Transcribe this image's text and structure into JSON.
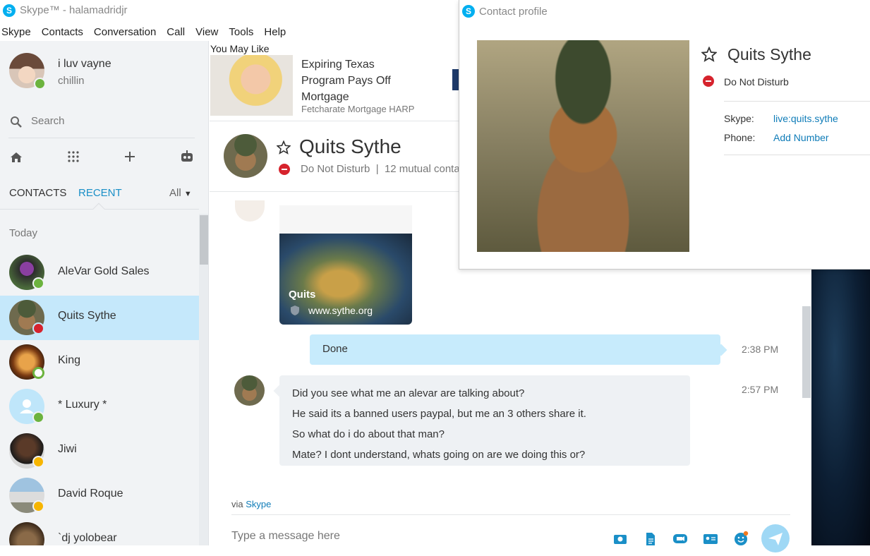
{
  "window": {
    "title": "Skype™ - halamadridjr"
  },
  "menu": [
    "Skype",
    "Contacts",
    "Conversation",
    "Call",
    "View",
    "Tools",
    "Help"
  ],
  "me": {
    "name": "i luv vayne",
    "mood": "chillin"
  },
  "search": {
    "placeholder": "Search"
  },
  "tabs": {
    "contacts": "CONTACTS",
    "recent": "RECENT",
    "filter": "All"
  },
  "section": "Today",
  "contacts": [
    {
      "name": "AleVar Gold Sales",
      "status": "online"
    },
    {
      "name": "Quits Sythe",
      "status": "dnd"
    },
    {
      "name": "King",
      "status": "offline"
    },
    {
      "name": "* Luxury *",
      "status": "online"
    },
    {
      "name": "Jiwi",
      "status": "away"
    },
    {
      "name": "David Roque",
      "status": "away"
    },
    {
      "name": "`dj yolobear",
      "status": "away"
    }
  ],
  "ad": {
    "header": "You May Like",
    "title_l1": "Expiring Texas",
    "title_l2": "Program Pays Off",
    "title_l3": "Mortgage",
    "source": "Fetcharate Mortgage HARP"
  },
  "conversation": {
    "name": "Quits Sythe",
    "status": "Do Not Disturb",
    "mutual": "12 mutual conta",
    "card": {
      "title": "Quits",
      "url": "www.sythe.org"
    },
    "outgoing": {
      "text": "Done",
      "time": "2:38 PM"
    },
    "incoming": {
      "time": "2:57 PM",
      "lines": [
        "Did you see what me an alevar are talking about?",
        "He said its a banned users paypal, but me an 3 others share it.",
        "So what do i do about that man?",
        "Mate? I dont understand, whats going on are we doing this or?"
      ]
    },
    "via_prefix": "via",
    "via_link": "Skype",
    "input_placeholder": "Type a message here"
  },
  "profile": {
    "window_title": "Contact profile",
    "name": "Quits Sythe",
    "status": "Do Not Disturb",
    "skype_label": "Skype:",
    "skype_value": "live:quits.sythe",
    "phone_label": "Phone:",
    "phone_value": "Add Number"
  },
  "colors": {
    "accent": "#00aff0",
    "selected": "#c5e8fb",
    "dnd": "#d6232d",
    "online": "#6cb33e",
    "away": "#f7b500",
    "link": "#0f7cb8"
  }
}
